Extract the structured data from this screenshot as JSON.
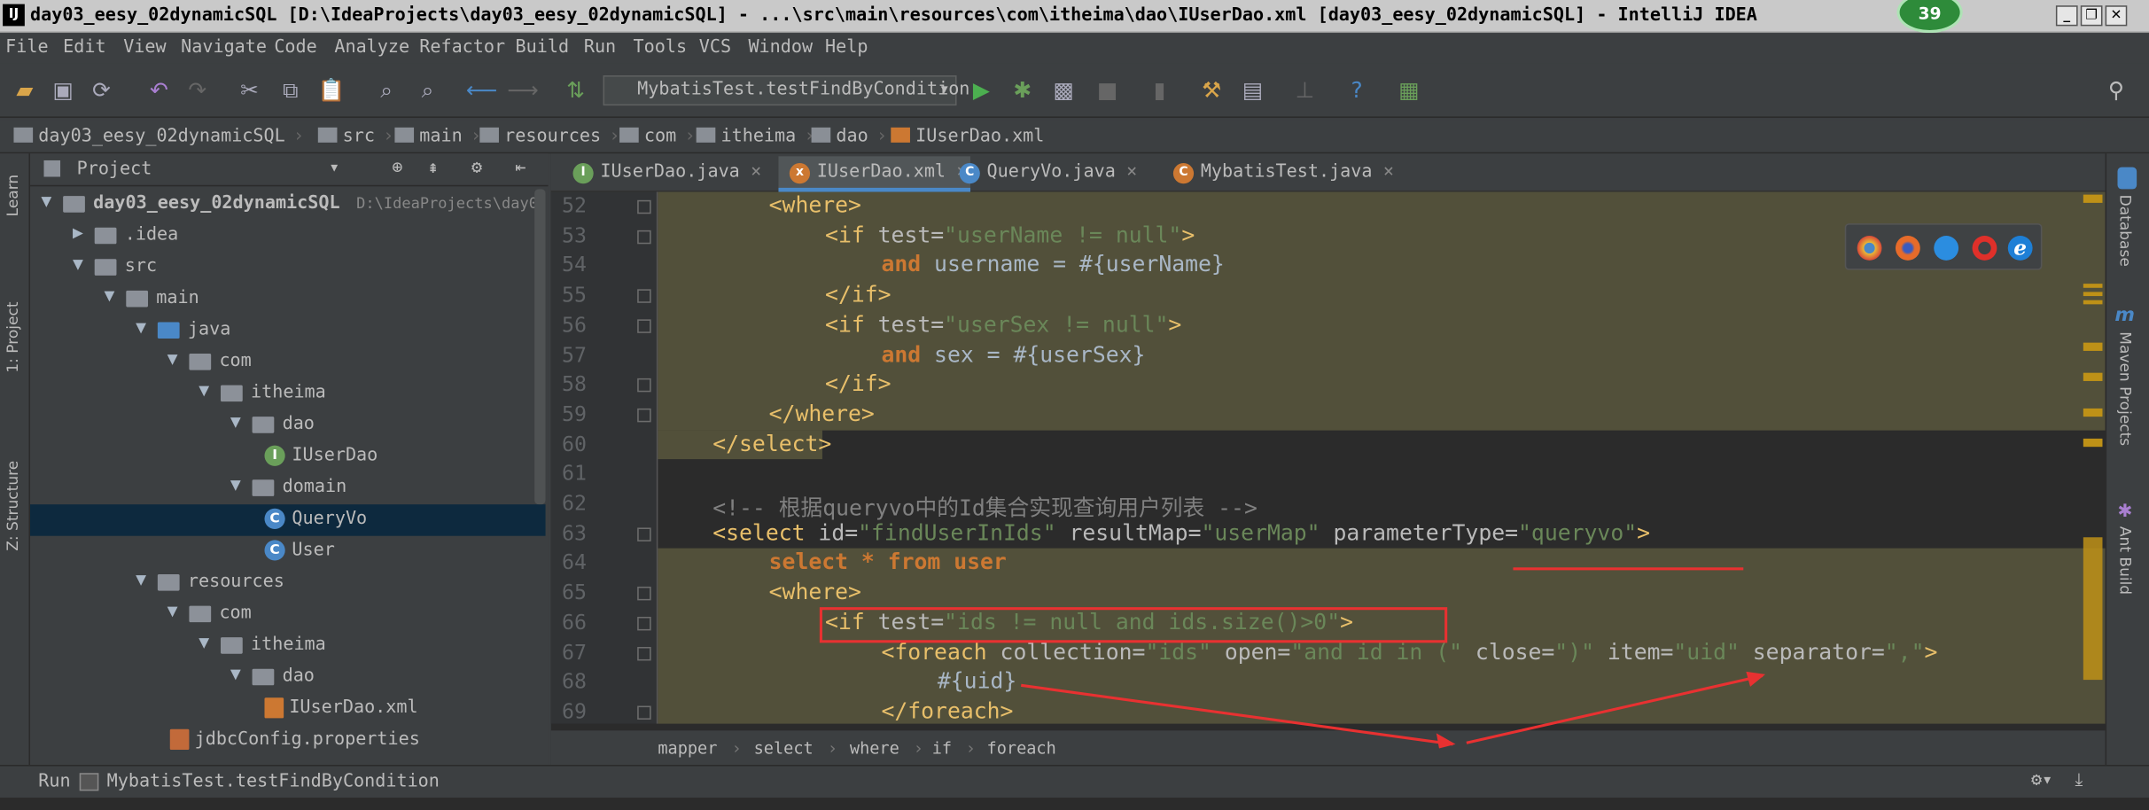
{
  "window": {
    "title": "day03_eesy_02dynamicSQL [D:\\IdeaProjects\\day03_eesy_02dynamicSQL] - ...\\src\\main\\resources\\com\\itheima\\dao\\IUserDao.xml [day03_eesy_02dynamicSQL] - IntelliJ IDEA",
    "badge": "39",
    "logo": "IJ"
  },
  "menu": [
    "File",
    "Edit",
    "View",
    "Navigate",
    "Code",
    "Analyze",
    "Refactor",
    "Build",
    "Run",
    "Tools",
    "VCS",
    "Window",
    "Help"
  ],
  "run_config": "MybatisTest.testFindByCondition",
  "nav": [
    "day03_eesy_02dynamicSQL",
    "src",
    "main",
    "resources",
    "com",
    "itheima",
    "dao",
    "IUserDao.xml"
  ],
  "left_strip": [
    "Learn",
    "1: Project",
    "Z: Structure"
  ],
  "right_strip": [
    "Database",
    "Maven Projects",
    "Ant Build"
  ],
  "project_panel": {
    "title": "Project",
    "root_path": "D:\\IdeaProjects\\day0",
    "tree": [
      {
        "label": "day03_eesy_02dynamicSQL",
        "depth": 0,
        "type": "module",
        "open": true
      },
      {
        "label": ".idea",
        "depth": 1,
        "type": "folder",
        "open": false
      },
      {
        "label": "src",
        "depth": 1,
        "type": "folder",
        "open": true
      },
      {
        "label": "main",
        "depth": 2,
        "type": "folder",
        "open": true
      },
      {
        "label": "java",
        "depth": 3,
        "type": "folder-blue",
        "open": true
      },
      {
        "label": "com",
        "depth": 4,
        "type": "folder",
        "open": true
      },
      {
        "label": "itheima",
        "depth": 5,
        "type": "folder",
        "open": true
      },
      {
        "label": "dao",
        "depth": 6,
        "type": "folder",
        "open": true
      },
      {
        "label": "IUserDao",
        "depth": 7,
        "type": "interface"
      },
      {
        "label": "domain",
        "depth": 6,
        "type": "folder",
        "open": true
      },
      {
        "label": "QueryVo",
        "depth": 7,
        "type": "class",
        "selected": true
      },
      {
        "label": "User",
        "depth": 7,
        "type": "class"
      },
      {
        "label": "resources",
        "depth": 3,
        "type": "folder",
        "open": true
      },
      {
        "label": "com",
        "depth": 4,
        "type": "folder",
        "open": true
      },
      {
        "label": "itheima",
        "depth": 5,
        "type": "folder",
        "open": true
      },
      {
        "label": "dao",
        "depth": 6,
        "type": "folder",
        "open": true
      },
      {
        "label": "IUserDao.xml",
        "depth": 7,
        "type": "xml"
      },
      {
        "label": "jdbcConfig.properties",
        "depth": 4,
        "type": "props"
      }
    ]
  },
  "tabs": [
    {
      "label": "IUserDao.java",
      "icon": "I",
      "color": "#6a9f5a",
      "active": false
    },
    {
      "label": "IUserDao.xml",
      "icon": "x",
      "color": "#cc7832",
      "active": true
    },
    {
      "label": "QueryVo.java",
      "icon": "C",
      "color": "#4a88c7",
      "active": false
    },
    {
      "label": "MybatisTest.java",
      "icon": "C",
      "color": "#cc7832",
      "active": false
    }
  ],
  "code": {
    "line_numbers": [
      "52",
      "53",
      "54",
      "55",
      "56",
      "57",
      "58",
      "59",
      "60",
      "61",
      "62",
      "63",
      "64",
      "65",
      "66",
      "67",
      "68",
      "69"
    ],
    "lines": [
      {
        "indent": 1,
        "tokens": [
          [
            "tag",
            "<where>"
          ]
        ]
      },
      {
        "indent": 2,
        "tokens": [
          [
            "tag",
            "<if "
          ],
          [
            "attr",
            "test="
          ],
          [
            "str",
            "\"userName != null\""
          ],
          [
            "tag",
            ">"
          ]
        ]
      },
      {
        "indent": 3,
        "tokens": [
          [
            "kw",
            "and "
          ],
          [
            "plain",
            "username = #{userName}"
          ]
        ]
      },
      {
        "indent": 2,
        "tokens": [
          [
            "tag",
            "</if>"
          ]
        ]
      },
      {
        "indent": 2,
        "tokens": [
          [
            "tag",
            "<if "
          ],
          [
            "attr",
            "test="
          ],
          [
            "str",
            "\"userSex != null\""
          ],
          [
            "tag",
            ">"
          ]
        ]
      },
      {
        "indent": 3,
        "tokens": [
          [
            "kw",
            "and "
          ],
          [
            "plain",
            "sex = #{userSex}"
          ]
        ]
      },
      {
        "indent": 2,
        "tokens": [
          [
            "tag",
            "</if>"
          ]
        ]
      },
      {
        "indent": 1,
        "tokens": [
          [
            "tag",
            "</where>"
          ]
        ]
      },
      {
        "indent": 0,
        "tokens": [
          [
            "tag",
            "</select>"
          ]
        ]
      },
      {
        "indent": 0,
        "tokens": []
      },
      {
        "indent": 0,
        "tokens": [
          [
            "comment",
            "<!-- 根据queryvo中的Id集合实现查询用户列表 -->"
          ]
        ]
      },
      {
        "indent": 0,
        "tokens": [
          [
            "tag",
            "<select "
          ],
          [
            "attr",
            "id="
          ],
          [
            "str",
            "\"findUserInIds\" "
          ],
          [
            "attr",
            "resultMap="
          ],
          [
            "str",
            "\"userMap\" "
          ],
          [
            "attr",
            "parameterType="
          ],
          [
            "str",
            "\"queryvo\""
          ],
          [
            "tag",
            ">"
          ]
        ]
      },
      {
        "indent": 1,
        "tokens": [
          [
            "kw",
            "select * from user"
          ]
        ]
      },
      {
        "indent": 1,
        "tokens": [
          [
            "tag",
            "<where>"
          ]
        ]
      },
      {
        "indent": 2,
        "tokens": [
          [
            "tag",
            "<if "
          ],
          [
            "attr",
            "test="
          ],
          [
            "str",
            "\"ids != null and ids.size()>0\""
          ],
          [
            "tag",
            ">"
          ]
        ]
      },
      {
        "indent": 3,
        "tokens": [
          [
            "tag",
            "<foreach "
          ],
          [
            "attr",
            "collection="
          ],
          [
            "str",
            "\"ids\" "
          ],
          [
            "attr",
            "open="
          ],
          [
            "str",
            "\"and id in (\" "
          ],
          [
            "attr",
            "close="
          ],
          [
            "str",
            "\")\" "
          ],
          [
            "attr",
            "item="
          ],
          [
            "str",
            "\"uid\" "
          ],
          [
            "attr",
            "separator="
          ],
          [
            "str",
            "\",\""
          ],
          [
            "tag",
            ">"
          ]
        ]
      },
      {
        "indent": 4,
        "tokens": [
          [
            "plain",
            "#{uid}"
          ]
        ]
      },
      {
        "indent": 3,
        "tokens": [
          [
            "tag",
            "</foreach>"
          ]
        ]
      }
    ]
  },
  "editor_breadcrumbs": [
    "mapper",
    "select",
    "where",
    "if",
    "foreach"
  ],
  "run_panel": {
    "label": "Run",
    "config": "MybatisTest.testFindByCondition"
  },
  "colors": {
    "annotation": "#e83131",
    "selection": "#0d293e",
    "highlight": "#52503a"
  }
}
